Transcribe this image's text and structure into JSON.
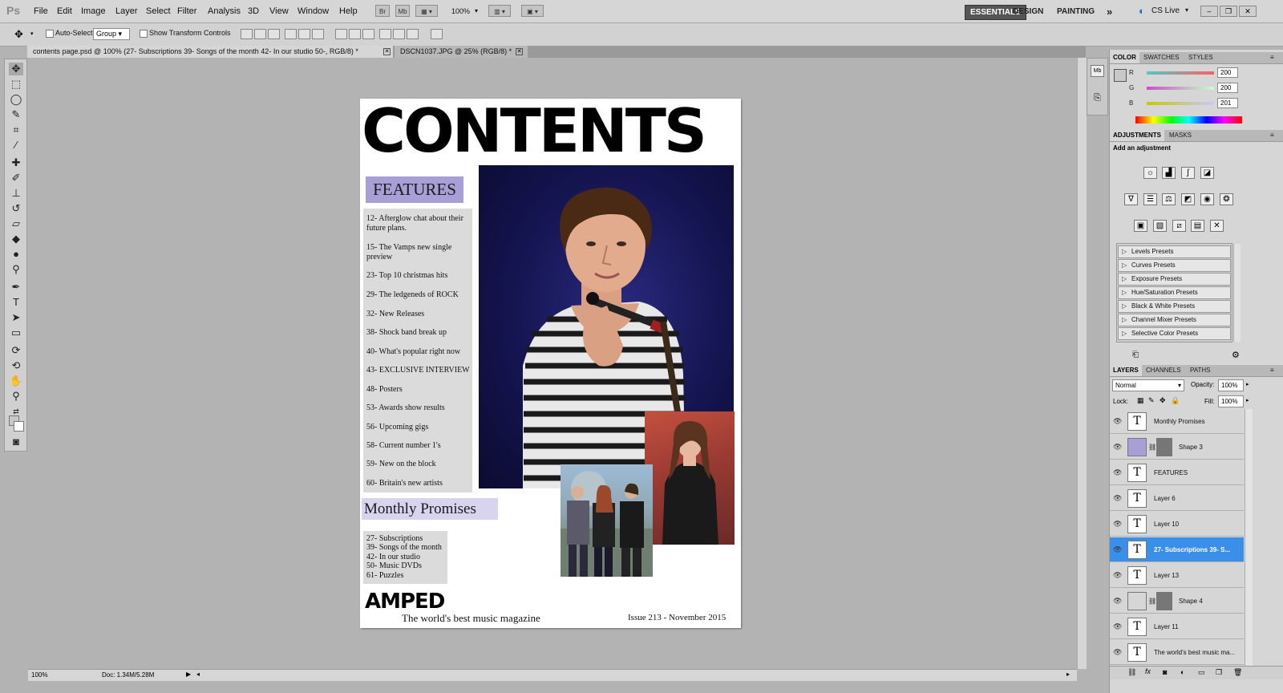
{
  "app": {
    "logo": "Ps"
  },
  "menu": [
    "File",
    "Edit",
    "Image",
    "Layer",
    "Select",
    "Filter",
    "Analysis",
    "3D",
    "View",
    "Window",
    "Help"
  ],
  "menubar_extra": {
    "br": "Br",
    "mb": "Mb",
    "zoom": "100%",
    "workspaces": [
      "ESSENTIALS",
      "DESIGN",
      "PAINTING"
    ],
    "more": "»",
    "cslive": "CS Live"
  },
  "options": {
    "auto_select_label": "Auto-Select:",
    "auto_select_value": "Group",
    "transform_label": "Show Transform Controls"
  },
  "tabs": [
    {
      "label": "contents page.psd @ 100% (27- Subscriptions 39- Songs of the month 42- In our studio 50-, RGB/8) *"
    },
    {
      "label": "DSCN1037.JPG @ 25% (RGB/8) *"
    }
  ],
  "status": {
    "zoom": "100%",
    "doc": "Doc: 1.34M/5.28M"
  },
  "document": {
    "title": "CONTENTS",
    "features_heading": "FEATURES",
    "features": [
      "12- Afterglow chat about their future plans.",
      "15- The Vamps new single preview",
      "23- Top 10 christmas hits",
      "29- The ledgeneds of ROCK",
      "32- New Releases",
      "38- Shock band break up",
      "40- What's popular right now",
      "43- EXCLUSIVE INTERVIEW",
      "48- Posters",
      "53- Awards show results",
      "56- Upcoming gigs",
      "58- Current number 1's",
      "59- New on the block",
      "60- Britain's new artists"
    ],
    "monthly_heading": "Monthly Promises",
    "monthly": [
      "27- Subscriptions",
      "39- Songs of the month",
      "42- In our studio",
      "50- Music DVDs",
      "61- Puzzles"
    ],
    "logo": "AMPED",
    "tagline": "The world's best music magazine",
    "issue": "Issue 213 - November 2015"
  },
  "color_panel": {
    "tabs": [
      "COLOR",
      "SWATCHES",
      "STYLES"
    ],
    "channels": [
      {
        "label": "R",
        "value": "200",
        "color": "#e04040"
      },
      {
        "label": "G",
        "value": "200",
        "color": "#d040c0"
      },
      {
        "label": "B",
        "value": "201",
        "color": "#c8c830"
      }
    ]
  },
  "adjustments_panel": {
    "tabs": [
      "ADJUSTMENTS",
      "MASKS"
    ],
    "heading": "Add an adjustment",
    "presets": [
      "Levels Presets",
      "Curves Presets",
      "Exposure Presets",
      "Hue/Saturation Presets",
      "Black & White Presets",
      "Channel Mixer Presets",
      "Selective Color Presets"
    ]
  },
  "layers_panel": {
    "tabs": [
      "LAYERS",
      "CHANNELS",
      "PATHS"
    ],
    "blend_mode": "Normal",
    "opacity_label": "Opacity:",
    "opacity": "100%",
    "lock_label": "Lock:",
    "fill_label": "Fill:",
    "fill": "100%",
    "layers": [
      {
        "name": "Monthly Promises",
        "type": "text"
      },
      {
        "name": "Shape 3",
        "type": "shape",
        "color": "#a89fd6"
      },
      {
        "name": "FEATURES",
        "type": "text"
      },
      {
        "name": "Layer 6",
        "type": "text"
      },
      {
        "name": "Layer 10",
        "type": "text"
      },
      {
        "name": "27- Subscriptions 39- S...",
        "type": "text",
        "selected": true
      },
      {
        "name": "Layer 13",
        "type": "text"
      },
      {
        "name": "Shape 4",
        "type": "shape",
        "color": "#d6d6d6"
      },
      {
        "name": "Layer 11",
        "type": "text"
      },
      {
        "name": "The world's best music ma...",
        "type": "text"
      }
    ]
  },
  "icons": {
    "text_layer": "T",
    "eye": "eye-icon"
  }
}
